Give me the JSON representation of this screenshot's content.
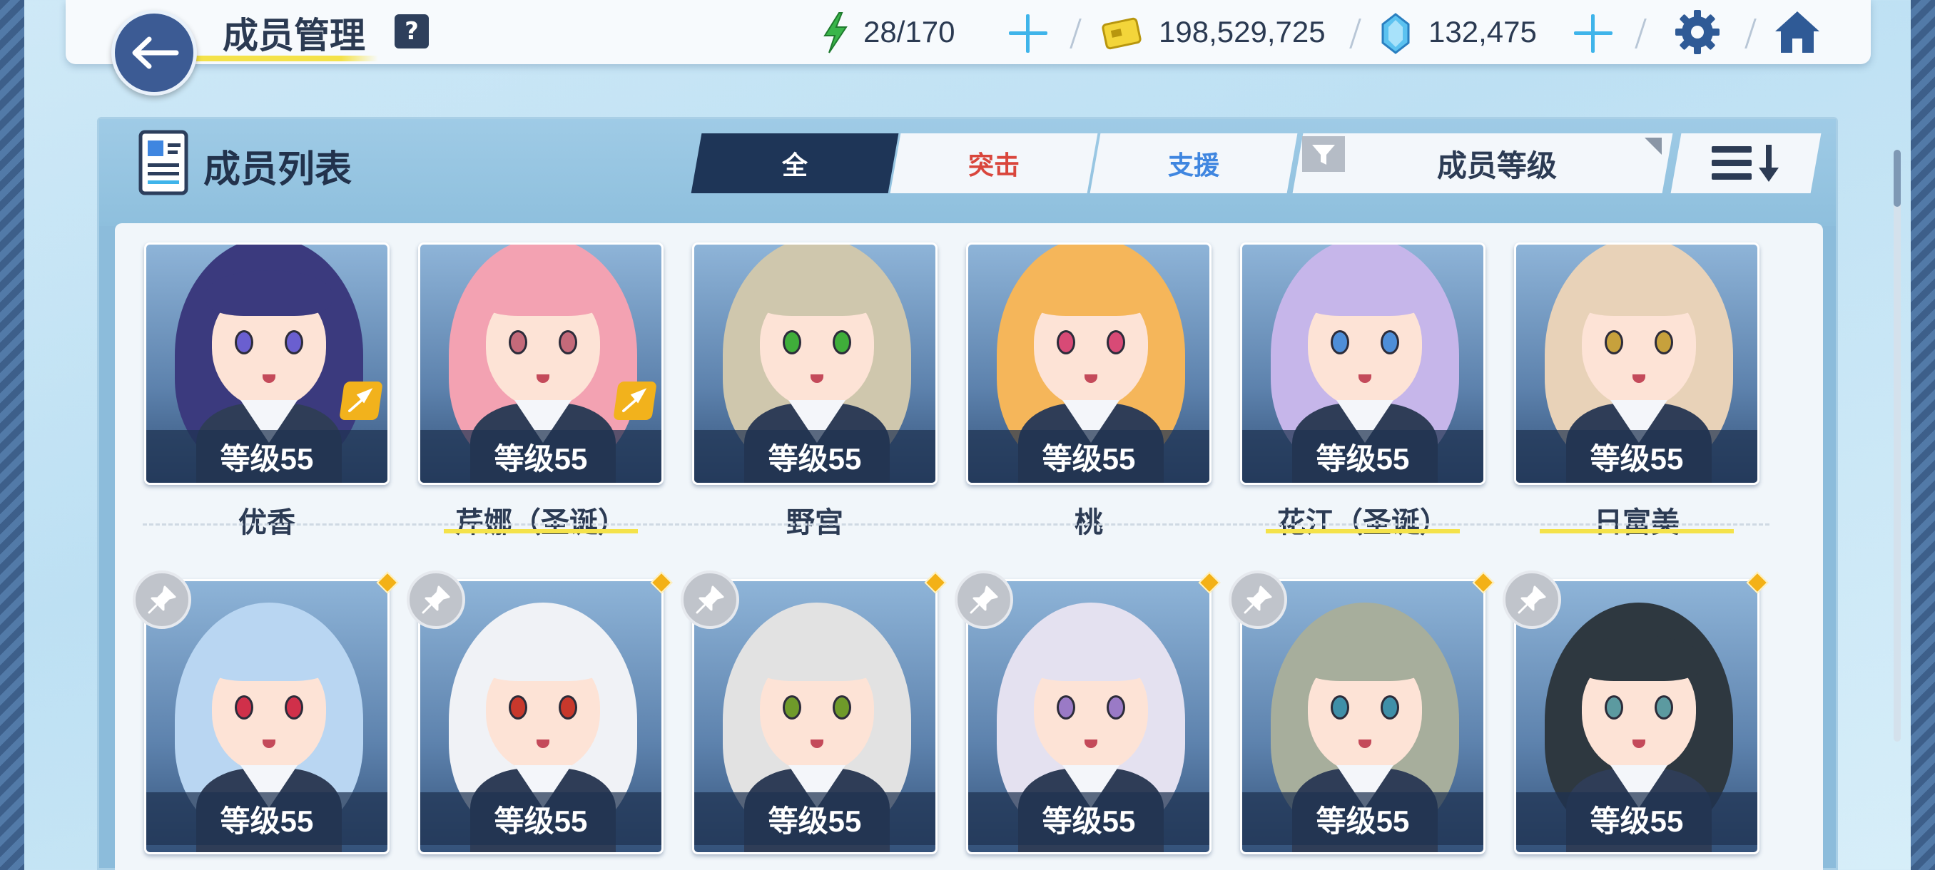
{
  "header": {
    "title": "成员管理",
    "help": "?",
    "stamina": "28/170",
    "credits": "198,529,725",
    "gems": "132,475"
  },
  "panel": {
    "title": "成员列表",
    "tabs": [
      {
        "label": "全",
        "color": "#ffffff"
      },
      {
        "label": "突击",
        "color": "#d9463c"
      },
      {
        "label": "支援",
        "color": "#3f86e0"
      }
    ],
    "sort_label": "成员等级"
  },
  "members_row1": [
    {
      "name": "优香",
      "level": "等级55",
      "hair": "#3b3a7e",
      "eye": "#6a5fd0",
      "striker": true
    },
    {
      "name": "芹娜（圣诞）",
      "level": "等级55",
      "hair": "#f3a2b2",
      "eye": "#c46a7a",
      "striker": true
    },
    {
      "name": "野宫",
      "level": "等级55",
      "hair": "#cfc7ad",
      "eye": "#3fae3a",
      "striker": false
    },
    {
      "name": "桃",
      "level": "等级55",
      "hair": "#f5b65a",
      "eye": "#d84a76",
      "striker": false
    },
    {
      "name": "花江（圣诞）",
      "level": "等级55",
      "hair": "#c6b6ea",
      "eye": "#4e8ed8",
      "striker": false
    },
    {
      "name": "日富美",
      "level": "等级55",
      "hair": "#e8d2b8",
      "eye": "#c7a13c",
      "striker": false
    }
  ],
  "members_row2": [
    {
      "level": "等级55",
      "hair": "#b9d6f2",
      "eye": "#d0304a"
    },
    {
      "level": "等级55",
      "hair": "#f0f2f6",
      "eye": "#c8382c"
    },
    {
      "level": "等级55",
      "hair": "#e2e2e2",
      "eye": "#6f9a2a"
    },
    {
      "level": "等级55",
      "hair": "#e4e1f0",
      "eye": "#9a7ac6"
    },
    {
      "level": "等级55",
      "hair": "#a7ae9c",
      "eye": "#3f8fa8"
    },
    {
      "level": "等级55",
      "hair": "#2e3840",
      "eye": "#5c9aa0"
    }
  ]
}
